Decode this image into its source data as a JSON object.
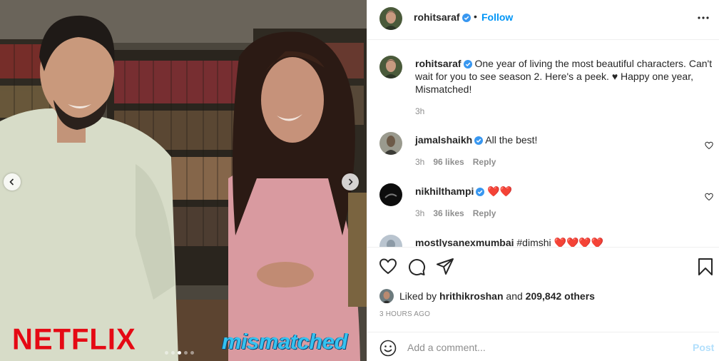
{
  "media": {
    "brand_left": "NETFLIX",
    "brand_right": "mismatched",
    "carousel": {
      "count": 5,
      "active_index": 2
    }
  },
  "post": {
    "author": "rohitsaraf",
    "follow_label": "Follow",
    "separator": "•",
    "caption": "One year of living the most beautiful characters. Can't wait for you to see season 2. Here's a peek. ♥ Happy one year, Mismatched!",
    "caption_time": "3h",
    "liked_by_prefix": "Liked by",
    "liked_by_user": "hrithikroshan",
    "liked_by_mid": "and",
    "liked_by_others": "209,842 others",
    "timestamp": "3 HOURS AGO",
    "comment_placeholder": "Add a comment...",
    "post_label": "Post"
  },
  "comments": [
    {
      "user": "jamalshaikh",
      "verified": true,
      "text": "All the best!",
      "time": "3h",
      "likes": "96 likes",
      "reply": "Reply"
    },
    {
      "user": "nikhilthampi",
      "verified": true,
      "text": "❤️❤️",
      "time": "3h",
      "likes": "36 likes",
      "reply": "Reply"
    },
    {
      "user": "mostlysanexmumbai",
      "verified": false,
      "text": "#dimshi ❤️❤️❤️❤️",
      "time": "",
      "likes": "",
      "reply": ""
    }
  ],
  "colors": {
    "accent": "#0095f6",
    "verified": "#3897f0",
    "heart_red": "#ed4956",
    "muted": "#8e8e8e",
    "netflix_red": "#e50914",
    "post_disabled": "#b2dffc"
  },
  "icons": [
    "verified-badge-icon",
    "more-options-icon",
    "heart-icon",
    "comment-icon",
    "share-icon",
    "bookmark-icon",
    "emoji-icon",
    "chevron-left-icon",
    "chevron-right-icon"
  ]
}
